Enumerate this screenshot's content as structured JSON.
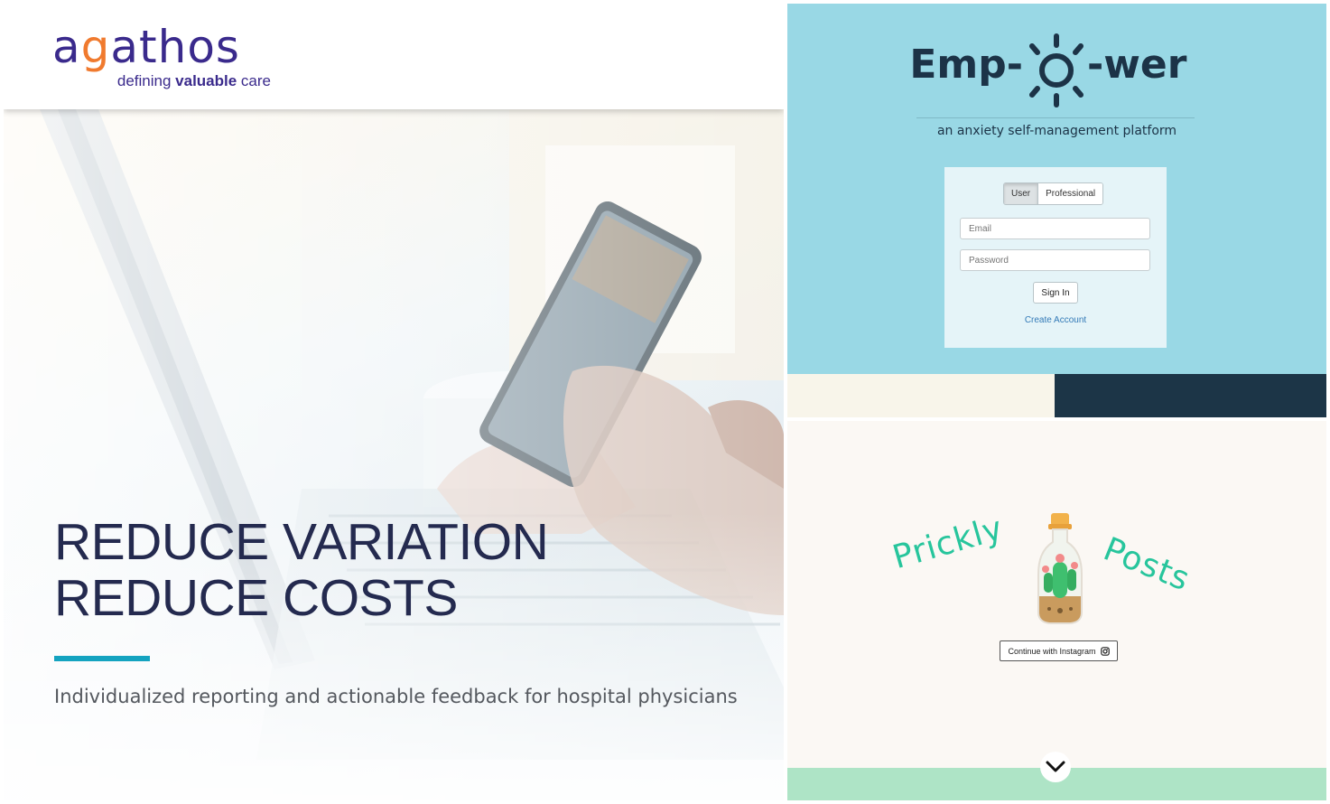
{
  "agathos": {
    "logo_text": "agathos",
    "tagline_pre": "defining ",
    "tagline_bold": "valuable",
    "tagline_post": " care",
    "headline_line1": "REDUCE VARIATION",
    "headline_line2": "REDUCE COSTS",
    "subheadline": "Individualized reporting and actionable feedback for hospital physicians",
    "colors": {
      "brand": "#3a2a8c",
      "logo_accent": "#f07a2e",
      "headline": "#242a4f",
      "rule": "#14a3c0"
    }
  },
  "empower": {
    "logo_left": "Emp-",
    "logo_right": "-wer",
    "tagline": "an anxiety self-management platform",
    "toggle": {
      "user_label": "User",
      "professional_label": "Professional",
      "selected": "User"
    },
    "email_placeholder": "Email",
    "password_placeholder": "Password",
    "signin_label": "Sign In",
    "create_account_label": "Create Account",
    "colors": {
      "background": "#99d8e5",
      "text": "#1c3347",
      "link": "#337ab7",
      "strip_dark": "#1c3547",
      "strip_light": "#f8f5ea"
    }
  },
  "prickly": {
    "word_left": "Prickly",
    "word_right": "Posts",
    "continue_label": "Continue with Instagram",
    "icons": {
      "instagram": "instagram-icon",
      "scroll": "chevron-down-icon",
      "illustration": "cactus-bottle"
    },
    "colors": {
      "title": "#27c59c",
      "footer": "#aee4c6",
      "background": "#fbf8f4"
    }
  }
}
